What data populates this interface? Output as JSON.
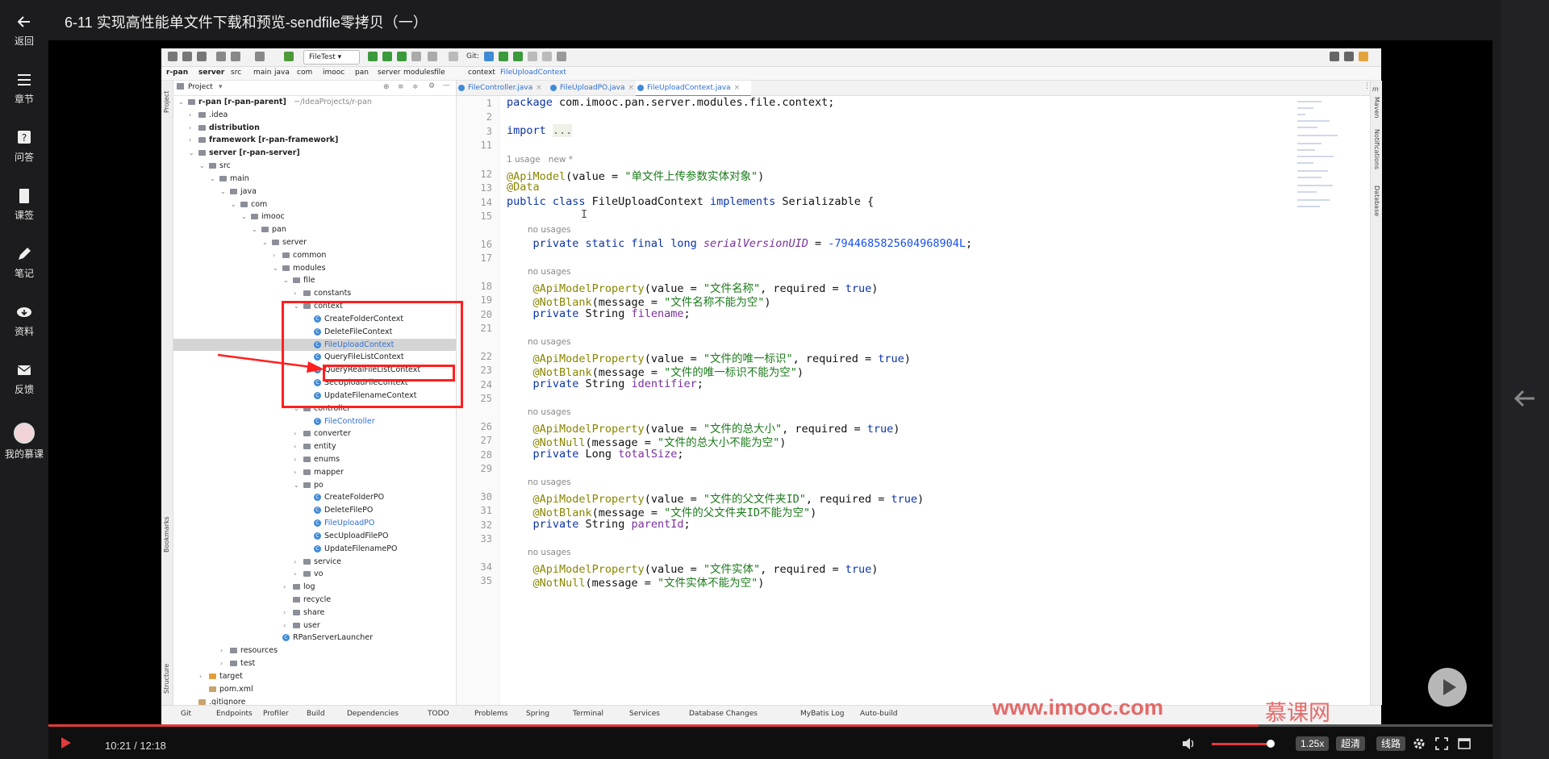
{
  "rail": {
    "back": "返回",
    "chapters": "章节",
    "qa": "问答",
    "lessons": "课签",
    "notes": "笔记",
    "materials": "资料",
    "feedback": "反馈",
    "mycourses": "我的慕课"
  },
  "title": "6-11 实现高性能单文件下载和预览-sendfile零拷贝（一）",
  "ide": {
    "run_config": "FileTest",
    "git_label": "Git:",
    "breadcrumb": [
      "r-pan",
      "server",
      "src",
      "main",
      "java",
      "com",
      "imooc",
      "pan",
      "server",
      "modules",
      "file",
      "context",
      "FileUploadContext"
    ],
    "project_label": "Project",
    "left_strip": [
      "Project",
      "Bookmarks",
      "Structure"
    ],
    "right_strip": [
      "m",
      "Maven",
      "Notifications",
      "Database"
    ],
    "tree": [
      {
        "label": "r-pan [r-pan-parent]",
        "hint": "~/IdeaProjects/r-pan"
      },
      {
        "label": ".idea"
      },
      {
        "label": "distribution"
      },
      {
        "label": "framework [r-pan-framework]"
      },
      {
        "label": "server [r-pan-server]"
      },
      {
        "label": "src"
      },
      {
        "label": "main"
      },
      {
        "label": "java"
      },
      {
        "label": "com"
      },
      {
        "label": "imooc"
      },
      {
        "label": "pan"
      },
      {
        "label": "server"
      },
      {
        "label": "common"
      },
      {
        "label": "modules"
      },
      {
        "label": "file"
      },
      {
        "label": "constants"
      },
      {
        "label": "context"
      },
      {
        "label": "CreateFolderContext"
      },
      {
        "label": "DeleteFileContext"
      },
      {
        "label": "FileUploadContext"
      },
      {
        "label": "QueryFileListContext"
      },
      {
        "label": "QueryRealFileListContext"
      },
      {
        "label": "SecUploadFileContext"
      },
      {
        "label": "UpdateFilenameContext"
      },
      {
        "label": "controller"
      },
      {
        "label": "FileController"
      },
      {
        "label": "converter"
      },
      {
        "label": "entity"
      },
      {
        "label": "enums"
      },
      {
        "label": "mapper"
      },
      {
        "label": "po"
      },
      {
        "label": "CreateFolderPO"
      },
      {
        "label": "DeleteFilePO"
      },
      {
        "label": "FileUploadPO"
      },
      {
        "label": "SecUploadFilePO"
      },
      {
        "label": "UpdateFilenamePO"
      },
      {
        "label": "service"
      },
      {
        "label": "vo"
      },
      {
        "label": "log"
      },
      {
        "label": "recycle"
      },
      {
        "label": "share"
      },
      {
        "label": "user"
      },
      {
        "label": "RPanServerLauncher"
      },
      {
        "label": "resources"
      },
      {
        "label": "test"
      },
      {
        "label": "target"
      },
      {
        "label": "pom.xml"
      },
      {
        "label": ".gitignore"
      }
    ],
    "tabs": [
      "FileController.java",
      "FileUploadPO.java",
      "FileUploadContext.java"
    ],
    "code": {
      "l1": "package com.imooc.pan.server.modules.file.context;",
      "l3": "import ...",
      "usage1": "1 usage   new *",
      "l12": "@ApiModel(value = \"单文件上传参数实体对象\")",
      "l13": "@Data",
      "l14": "public class FileUploadContext implements Serializable {",
      "nu": "no usages",
      "l16": "    private static final long serialVersionUID = -7944685825604968904L;",
      "l18": "    @ApiModelProperty(value = \"文件名称\", required = true)",
      "l19": "    @NotBlank(message = \"文件名称不能为空\")",
      "l20": "    private String filename;",
      "l22": "    @ApiModelProperty(value = \"文件的唯一标识\", required = true)",
      "l23": "    @NotBlank(message = \"文件的唯一标识不能为空\")",
      "l24": "    private String identifier;",
      "l26": "    @ApiModelProperty(value = \"文件的总大小\", required = true)",
      "l27": "    @NotNull(message = \"文件的总大小不能为空\")",
      "l28": "    private Long totalSize;",
      "l30": "    @ApiModelProperty(value = \"文件的父文件夹ID\", required = true)",
      "l31": "    @NotBlank(message = \"文件的父文件夹ID不能为空\")",
      "l32": "    private String parentId;",
      "l34": "    @ApiModelProperty(value = \"文件实体\", required = true)",
      "l35": "    @NotNull(message = \"文件实体不能为空\")"
    },
    "line_numbers": [
      "1",
      "2",
      "3",
      "11",
      "12",
      "13",
      "14",
      "15",
      "16",
      "17",
      "18",
      "19",
      "20",
      "21",
      "22",
      "23",
      "24",
      "25",
      "26",
      "27",
      "28",
      "29",
      "30",
      "31",
      "32",
      "33",
      "34",
      "35"
    ],
    "status": [
      "Git",
      "Endpoints",
      "Profiler",
      "Build",
      "Dependencies",
      "TODO",
      "Problems",
      "Spring",
      "Terminal",
      "Services",
      "Database Changes",
      "MyBatis Log",
      "Auto-build"
    ]
  },
  "watermark": {
    "url": "www.imooc.com",
    "brand": "慕课网"
  },
  "player": {
    "time": "10:21 / 12:18",
    "speed": "1.25x",
    "quality": "超清",
    "route": "线路",
    "progress_fraction": 0.838
  }
}
